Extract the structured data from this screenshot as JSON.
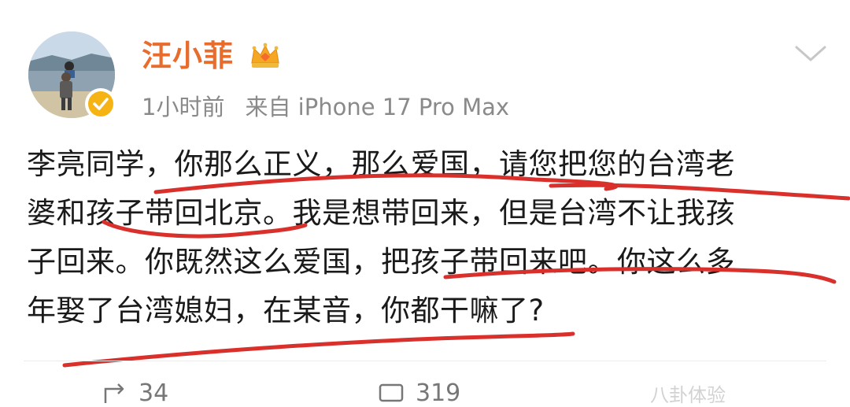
{
  "post": {
    "author": "汪小菲",
    "author_badge_icon": "vip-crown-icon",
    "verified_icon": "verified-check-icon",
    "time": "1小时前",
    "source": "来自 iPhone 17 Pro Max",
    "menu_icon": "chevron-down-icon",
    "lines": [
      "李亮同学，你那么正义，那么爱国，请您把您的台湾老",
      "婆和孩子带回北京。我是想带回来，但是台湾不让我孩",
      "子回来。你既然这么爱国，把孩子带回来吧。你这么多",
      "年娶了台湾媳妇，在某音，你都干嘛了?"
    ],
    "annotation_color": "#d9302c"
  },
  "actions": {
    "repost_icon": "repost-icon",
    "repost_count": "34",
    "comment_icon": "comment-icon",
    "comment_count": "319"
  },
  "watermark": "八卦体验",
  "colors": {
    "author_name": "#e86c2c",
    "verified": "#f6b314",
    "meta": "#8a8a8a"
  }
}
